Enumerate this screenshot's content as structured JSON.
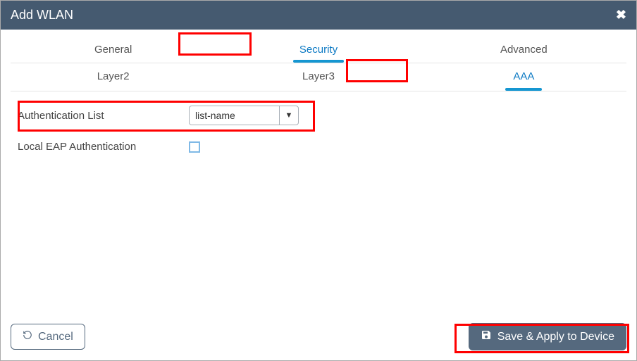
{
  "title": "Add WLAN",
  "tabs": {
    "general": "General",
    "security": "Security",
    "advanced": "Advanced"
  },
  "subtabs": {
    "layer2": "Layer2",
    "layer3": "Layer3",
    "aaa": "AAA"
  },
  "form": {
    "auth_list_label": "Authentication List",
    "auth_list_value": "list-name",
    "local_eap_label": "Local EAP Authentication",
    "local_eap_checked": false
  },
  "buttons": {
    "cancel": "Cancel",
    "save": "Save & Apply to Device"
  }
}
